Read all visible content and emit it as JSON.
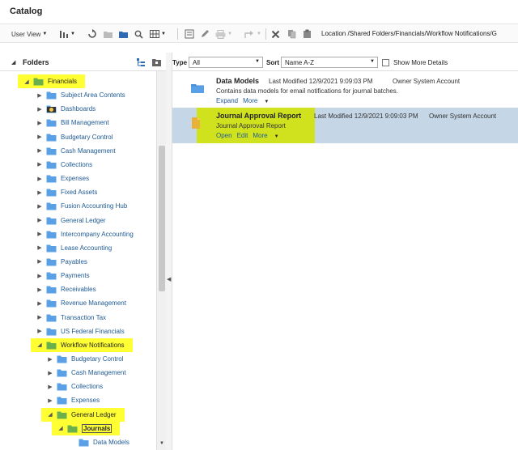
{
  "title": "Catalog",
  "toolbar": {
    "user_view": "User View",
    "location_label": "Location",
    "location_path": "/Shared Folders/Financials/Workflow Notifications/G"
  },
  "left": {
    "header": "Folders",
    "tree": [
      {
        "label": "Financials",
        "level": 0,
        "expanded": true,
        "highlight": true,
        "icon": "folder-green-icon"
      },
      {
        "label": "Subject Area Contents",
        "level": 1,
        "expanded": false,
        "icon": "folder-icon"
      },
      {
        "label": "Dashboards",
        "level": 1,
        "expanded": false,
        "icon": "dashboard-folder-icon"
      },
      {
        "label": "Bill Management",
        "level": 1,
        "expanded": false,
        "icon": "folder-icon"
      },
      {
        "label": "Budgetary Control",
        "level": 1,
        "expanded": false,
        "icon": "folder-icon"
      },
      {
        "label": "Cash Management",
        "level": 1,
        "expanded": false,
        "icon": "folder-icon"
      },
      {
        "label": "Collections",
        "level": 1,
        "expanded": false,
        "icon": "folder-icon"
      },
      {
        "label": "Expenses",
        "level": 1,
        "expanded": false,
        "icon": "folder-icon"
      },
      {
        "label": "Fixed Assets",
        "level": 1,
        "expanded": false,
        "icon": "folder-icon"
      },
      {
        "label": "Fusion Accounting Hub",
        "level": 1,
        "expanded": false,
        "icon": "folder-icon"
      },
      {
        "label": "General Ledger",
        "level": 1,
        "expanded": false,
        "icon": "folder-icon"
      },
      {
        "label": "Intercompany Accounting",
        "level": 1,
        "expanded": false,
        "icon": "folder-icon"
      },
      {
        "label": "Lease Accounting",
        "level": 1,
        "expanded": false,
        "icon": "folder-icon"
      },
      {
        "label": "Payables",
        "level": 1,
        "expanded": false,
        "icon": "folder-icon"
      },
      {
        "label": "Payments",
        "level": 1,
        "expanded": false,
        "icon": "folder-icon"
      },
      {
        "label": "Receivables",
        "level": 1,
        "expanded": false,
        "icon": "folder-icon"
      },
      {
        "label": "Revenue Management",
        "level": 1,
        "expanded": false,
        "icon": "folder-icon"
      },
      {
        "label": "Transaction Tax",
        "level": 1,
        "expanded": false,
        "icon": "folder-icon"
      },
      {
        "label": "US Federal Financials",
        "level": 1,
        "expanded": false,
        "icon": "folder-icon"
      },
      {
        "label": "Workflow Notifications",
        "level": 1,
        "expanded": true,
        "highlight": true,
        "icon": "folder-green-icon"
      },
      {
        "label": "Budgetary Control",
        "level": 2,
        "expanded": false,
        "icon": "folder-icon"
      },
      {
        "label": "Cash Management",
        "level": 2,
        "expanded": false,
        "icon": "folder-icon"
      },
      {
        "label": "Collections",
        "level": 2,
        "expanded": false,
        "icon": "folder-icon"
      },
      {
        "label": "Expenses",
        "level": 2,
        "expanded": false,
        "icon": "folder-icon"
      },
      {
        "label": "General Ledger",
        "level": 2,
        "expanded": true,
        "highlight": true,
        "icon": "folder-green-icon"
      },
      {
        "label": "Journals",
        "level": 3,
        "expanded": true,
        "highlight": true,
        "icon": "folder-green-icon",
        "selected": true
      },
      {
        "label": "Data Models",
        "level": 4,
        "leaf": true,
        "icon": "folder-icon"
      }
    ]
  },
  "filter": {
    "type_label": "Type",
    "type_value": "All",
    "sort_label": "Sort",
    "sort_value": "Name A-Z",
    "show_more": "Show More Details"
  },
  "items": [
    {
      "name": "Data Models",
      "modified": "Last Modified 12/9/2021 9:09:03 PM",
      "owner": "Owner System Account",
      "desc": "Contains data models for email notifications for journal batches.",
      "links": [
        "Expand",
        "More"
      ]
    },
    {
      "name": "Journal Approval Report",
      "modified": "Last Modified 12/9/2021 9:09:03 PM",
      "owner": "Owner System Account",
      "desc": "Journal Approval Report",
      "links": [
        "Open",
        "Edit",
        "More"
      ]
    }
  ],
  "colors": {
    "highlight": "#ffff33",
    "selected_row": "#c5d6e6",
    "selected_block": "#d0e21e",
    "link": "#1f5a93"
  }
}
